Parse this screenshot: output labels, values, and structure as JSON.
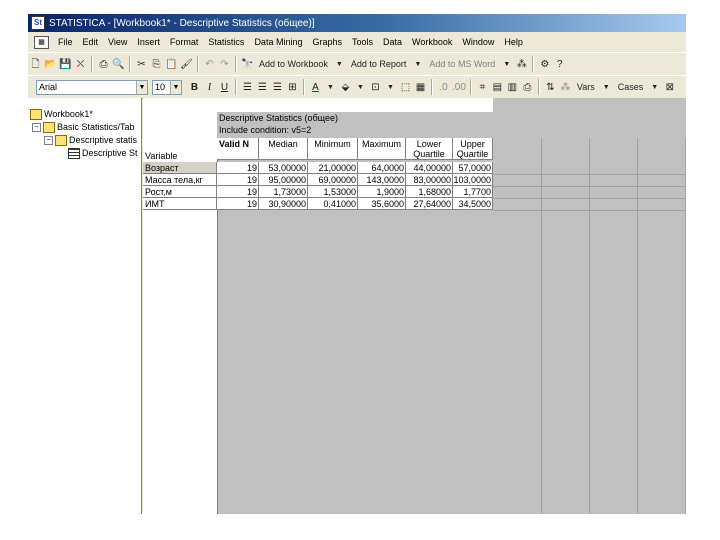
{
  "window": {
    "title": "STATISTICA - [Workbook1* - Descriptive Statistics (общее)]",
    "icon": "statistica-app-icon"
  },
  "menu": {
    "items": [
      "File",
      "Edit",
      "View",
      "Insert",
      "Format",
      "Statistics",
      "Data Mining",
      "Graphs",
      "Tools",
      "Data",
      "Workbook",
      "Window",
      "Help"
    ]
  },
  "toolbar1": {
    "add_to_workbook": "Add to Workbook",
    "add_to_report": "Add to Report",
    "add_to_ms_word": "Add to MS Word"
  },
  "toolbar2": {
    "font_name": "Arial",
    "font_size": "10",
    "bold": "B",
    "italic": "I",
    "underline": "U",
    "vars": "Vars",
    "cases": "Cases"
  },
  "tree": {
    "root": "Workbook1*",
    "level1": "Basic Statistics/Tab",
    "level2": "Descriptive statis",
    "level3": "Descriptive St"
  },
  "sheet": {
    "title": "Descriptive Statistics (общее)",
    "condition": "Include condition: v5=2",
    "variable_label": "Variable",
    "columns": [
      {
        "label": "Valid N",
        "sub": ""
      },
      {
        "label": "Median",
        "sub": ""
      },
      {
        "label": "Minimum",
        "sub": ""
      },
      {
        "label": "Maximum",
        "sub": ""
      },
      {
        "label": "Lower",
        "sub": "Quartile"
      },
      {
        "label": "Upper",
        "sub": "Quartile"
      }
    ],
    "rows": [
      {
        "name": "Возраст",
        "values": [
          "19",
          "53,00000",
          "21,00000",
          "64,0000",
          "44,00000",
          "57,0000"
        ]
      },
      {
        "name": "Масса тела,кг",
        "values": [
          "19",
          "95,00000",
          "69,00000",
          "143,0000",
          "83,00000",
          "103,0000"
        ]
      },
      {
        "name": "Рост,м",
        "values": [
          "19",
          "1,73000",
          "1,53000",
          "1,9000",
          "1,68000",
          "1,7700"
        ]
      },
      {
        "name": "ИМТ",
        "values": [
          "19",
          "30,90000",
          "0,41000",
          "35,6000",
          "27,64000",
          "34,5000"
        ]
      }
    ]
  }
}
